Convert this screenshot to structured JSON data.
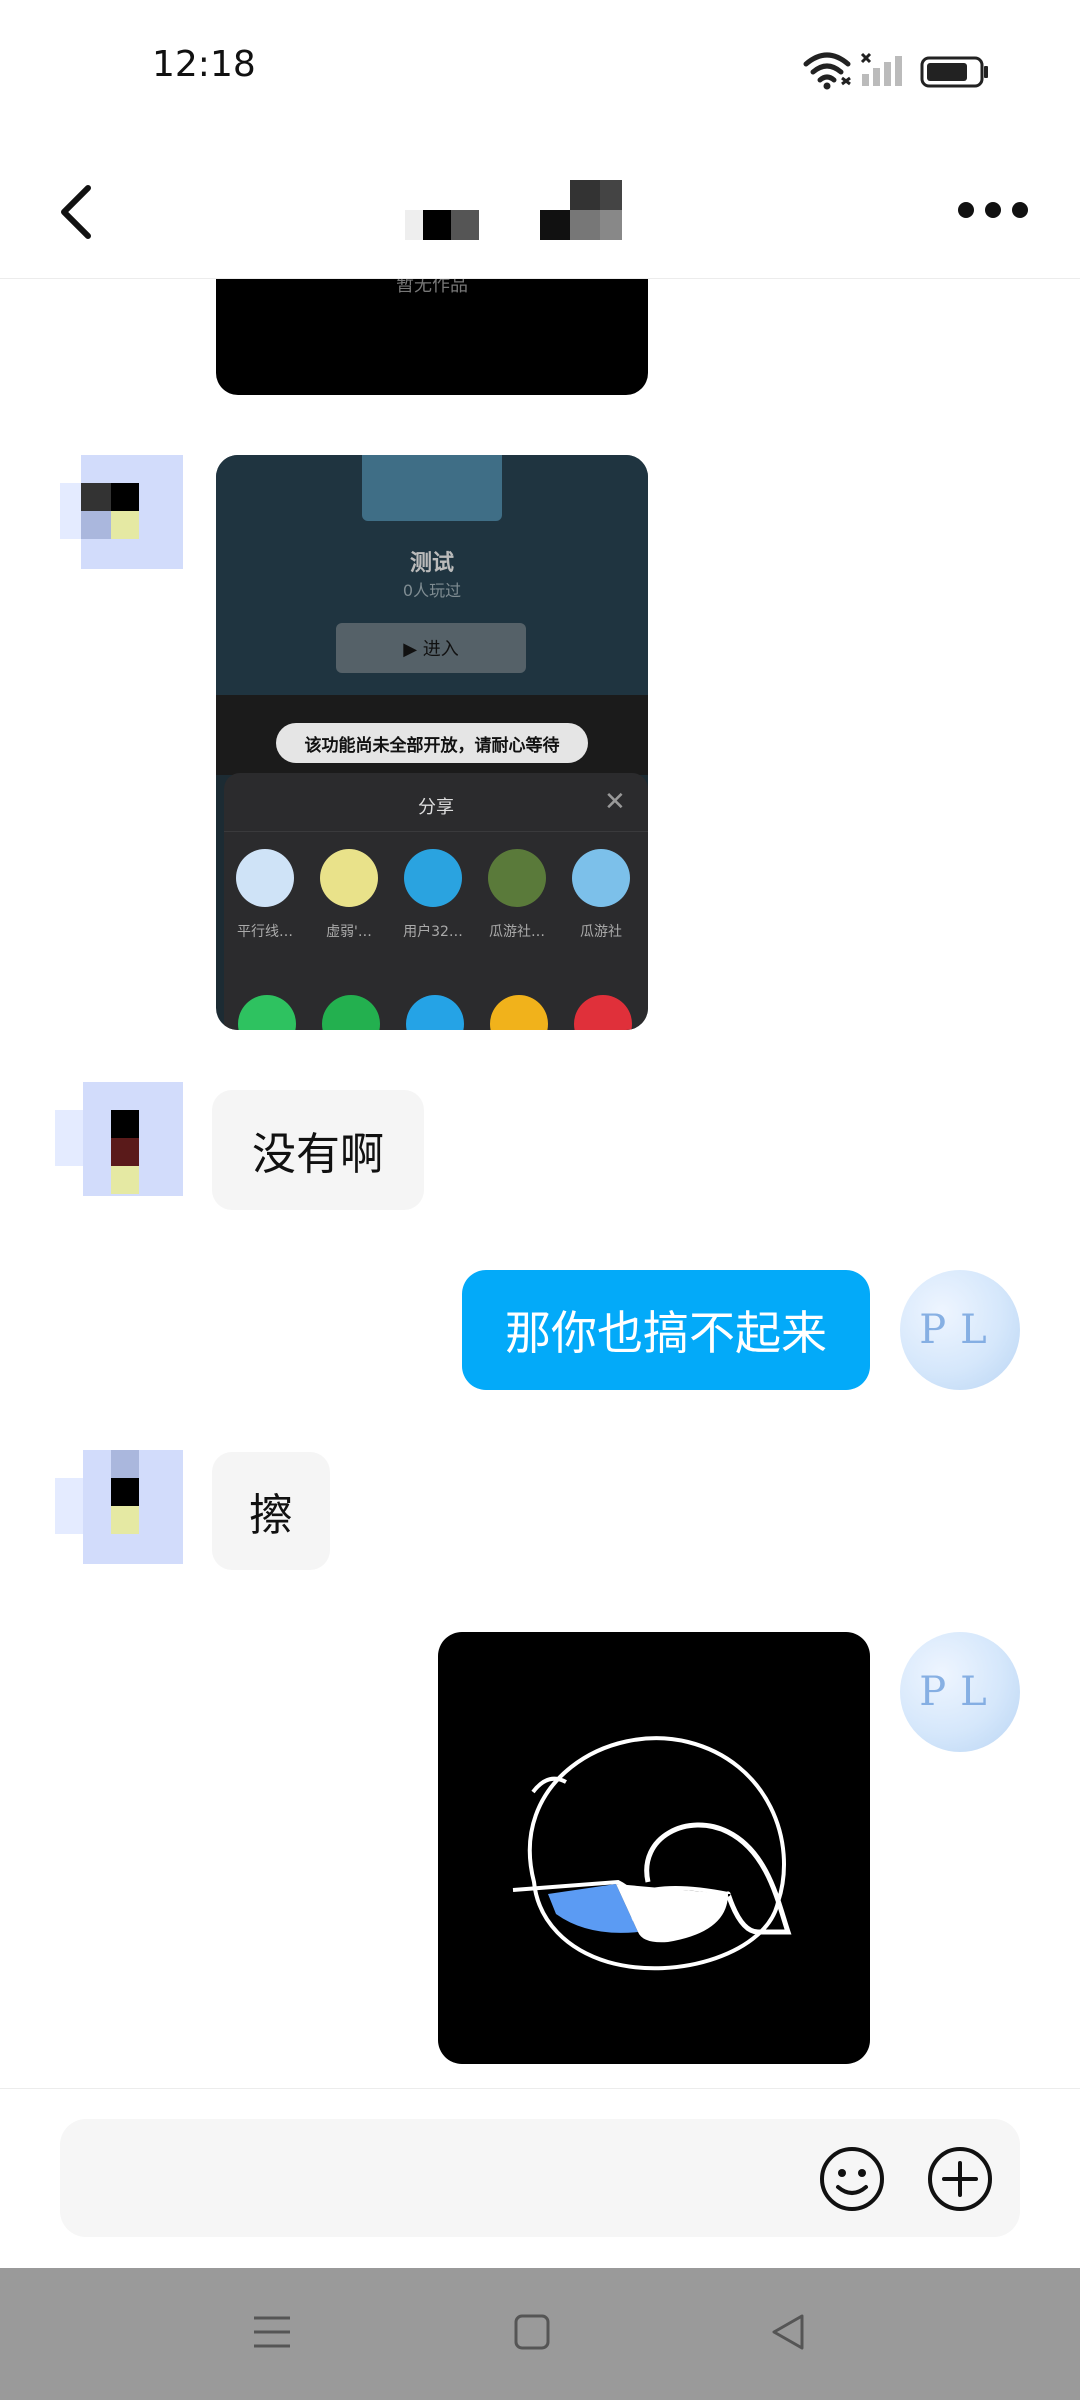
{
  "status_bar": {
    "time": "12:18"
  },
  "header": {
    "title": ""
  },
  "shared_screenshot": {
    "caption_top": "暂无作品",
    "game_title": "测试",
    "play_count": "0人玩过",
    "enter_label": "▶ 进入",
    "toast": "该功能尚未全部开放，请耐心等待",
    "share_title": "分享",
    "share_targets": [
      {
        "label": "平行线…",
        "color": "#cfe3f7"
      },
      {
        "label": "虚弱'…",
        "color": "#e9e28a"
      },
      {
        "label": "用户32…",
        "color": "#2aa3e0"
      },
      {
        "label": "瓜游社…",
        "color": "#5a7a3a"
      },
      {
        "label": "瓜游社",
        "color": "#7cc0ea"
      }
    ],
    "share_apps": [
      "#2ec260",
      "#23b04f",
      "#25a3e6",
      "#f1b21b",
      "#e0303a"
    ]
  },
  "messages": [
    {
      "side": "in",
      "text": "没有啊"
    },
    {
      "side": "out",
      "text": "那你也搞不起来"
    },
    {
      "side": "in",
      "text": "擦"
    }
  ],
  "avatar_out_text": "PL",
  "input": {
    "placeholder": ""
  },
  "colors": {
    "accent": "#03aaf9",
    "bubble_in": "#f5f5f5",
    "nav_bar": "#9a9a9a"
  },
  "icons": [
    "back-arrow-icon",
    "more-dots-icon",
    "wifi-icon",
    "signal-icon",
    "battery-icon",
    "emoji-icon",
    "plus-icon",
    "menu-icon",
    "home-square-icon",
    "back-triangle-icon"
  ]
}
